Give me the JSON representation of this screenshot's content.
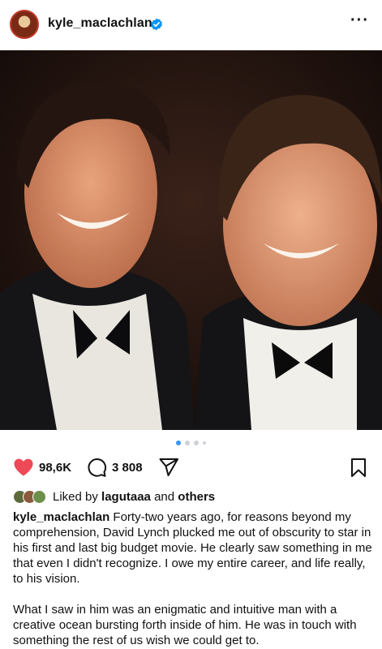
{
  "post": {
    "username": "kyle_maclachlan",
    "verified": true,
    "more_icon": "more-horizontal-icon"
  },
  "carousel": {
    "slides": 4,
    "active_index": 0
  },
  "actions": {
    "like_icon": "heart-filled-icon",
    "like_color": "#ed4956",
    "likes_count": "98,6K",
    "comment_icon": "comment-icon",
    "comments_count": "3 808",
    "share_icon": "paper-plane-icon",
    "save_icon": "bookmark-icon"
  },
  "liked_by": {
    "prefix": "Liked by",
    "user": "lagutaaa",
    "connector": "and",
    "suffix": "others"
  },
  "caption": {
    "username": "kyle_maclachlan",
    "paragraph1": "Forty-two years ago, for reasons beyond my comprehension, David Lynch plucked me out of obscurity to star in his first and last big budget movie. He clearly saw something in me that even I didn't recognize. I owe my entire career, and life really, to his vision.",
    "paragraph2": "What I saw in him was an enigmatic and intuitive man with a creative ocean bursting forth inside of him. He was in touch with something the rest of us wish we could get to."
  },
  "colors": {
    "accent_blue": "#3897f0",
    "verified_blue": "#0095f6",
    "heart_red": "#ed4956"
  }
}
